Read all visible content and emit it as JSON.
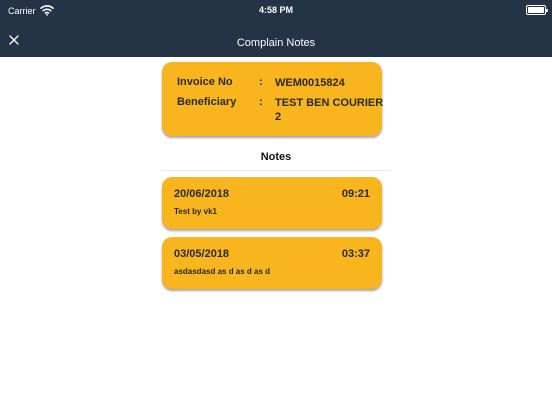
{
  "status_bar": {
    "carrier": "Carrier",
    "time": "4:58 PM",
    "wifi_icon": "wifi-icon",
    "battery_icon": "battery-icon"
  },
  "nav": {
    "title": "Complain Notes",
    "close_icon": "close-icon"
  },
  "invoice": {
    "invoice_label": "Invoice No",
    "invoice_colon": ":",
    "invoice_value": "WEM0015824",
    "beneficiary_label": "Beneficiary",
    "beneficiary_colon": ":",
    "beneficiary_value": "TEST BEN COURIER 2"
  },
  "notes_heading": "Notes",
  "notes": [
    {
      "date": "20/06/2018",
      "time": "09:21",
      "text": "Test by vk1"
    },
    {
      "date": "03/05/2018",
      "time": "03:37",
      "text": "asdasdasd as d as d as d"
    }
  ],
  "colors": {
    "nav_bg": "#253347",
    "card_bg": "#f8b51e",
    "page_bg": "#ffffff"
  }
}
